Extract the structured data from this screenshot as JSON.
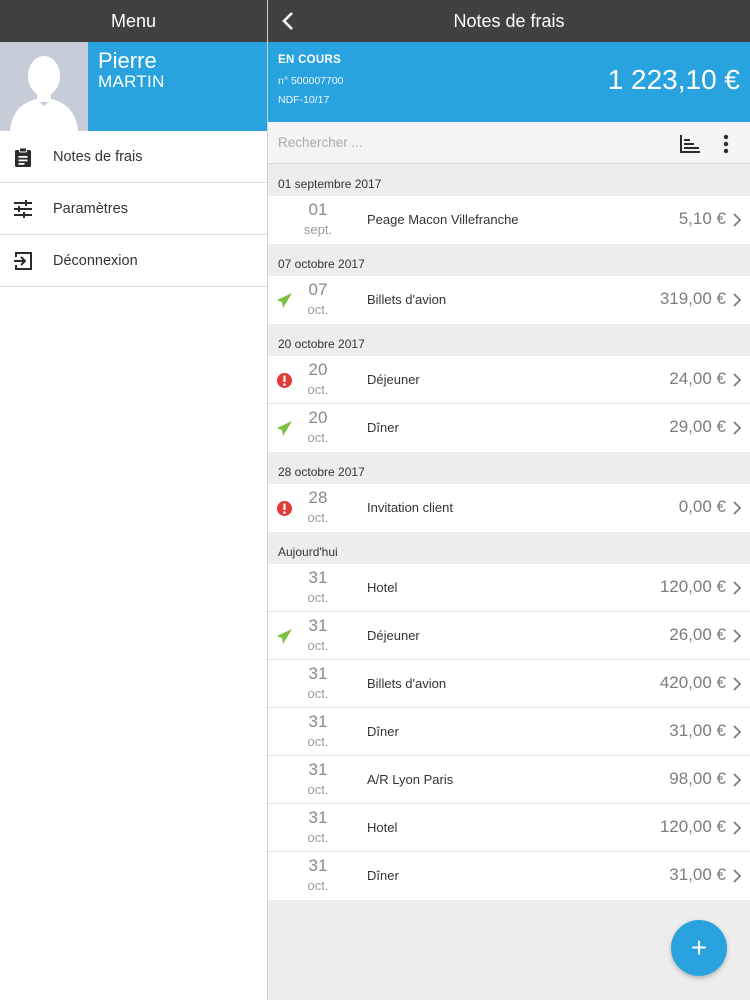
{
  "sidebar": {
    "title": "Menu",
    "user": {
      "first_name": "Pierre",
      "last_name": "MARTIN"
    },
    "items": [
      {
        "label": "Notes de frais",
        "icon": "clipboard-icon"
      },
      {
        "label": "Paramètres",
        "icon": "sliders-icon"
      },
      {
        "label": "Déconnexion",
        "icon": "logout-icon"
      }
    ]
  },
  "header": {
    "title": "Notes de frais"
  },
  "summary": {
    "status": "EN COURS",
    "number": "n° 500007700",
    "reference": "NDF-10/17",
    "total": "1 223,10 €"
  },
  "search": {
    "placeholder": "Rechercher ..."
  },
  "colors": {
    "accent": "#29a3e0",
    "topbar": "#414141",
    "sent": "#7bc043",
    "error": "#e53935"
  },
  "groups": [
    {
      "date": "01 septembre 2017",
      "rows": [
        {
          "status": "",
          "day": "01",
          "month": "sept.",
          "label": "Peage Macon Villefranche",
          "amount": "5,10 €"
        }
      ]
    },
    {
      "date": "07 octobre 2017",
      "rows": [
        {
          "status": "sent",
          "day": "07",
          "month": "oct.",
          "label": "Billets d'avion",
          "amount": "319,00 €"
        }
      ]
    },
    {
      "date": "20 octobre 2017",
      "rows": [
        {
          "status": "error",
          "day": "20",
          "month": "oct.",
          "label": "Déjeuner",
          "amount": "24,00 €"
        },
        {
          "status": "sent",
          "day": "20",
          "month": "oct.",
          "label": "Dîner",
          "amount": "29,00 €"
        }
      ]
    },
    {
      "date": "28 octobre 2017",
      "rows": [
        {
          "status": "error",
          "day": "28",
          "month": "oct.",
          "label": "Invitation client",
          "amount": "0,00 €"
        }
      ]
    },
    {
      "date": "Aujourd'hui",
      "rows": [
        {
          "status": "",
          "day": "31",
          "month": "oct.",
          "label": "Hotel",
          "amount": "120,00 €"
        },
        {
          "status": "sent",
          "day": "31",
          "month": "oct.",
          "label": "Déjeuner",
          "amount": "26,00 €"
        },
        {
          "status": "",
          "day": "31",
          "month": "oct.",
          "label": "Billets d'avion",
          "amount": "420,00 €"
        },
        {
          "status": "",
          "day": "31",
          "month": "oct.",
          "label": "Dîner",
          "amount": "31,00 €"
        },
        {
          "status": "",
          "day": "31",
          "month": "oct.",
          "label": "A/R Lyon Paris",
          "amount": "98,00 €"
        },
        {
          "status": "",
          "day": "31",
          "month": "oct.",
          "label": "Hotel",
          "amount": "120,00 €"
        },
        {
          "status": "",
          "day": "31",
          "month": "oct.",
          "label": "Dîner",
          "amount": "31,00 €"
        }
      ]
    }
  ],
  "fab": {
    "label": "+"
  }
}
